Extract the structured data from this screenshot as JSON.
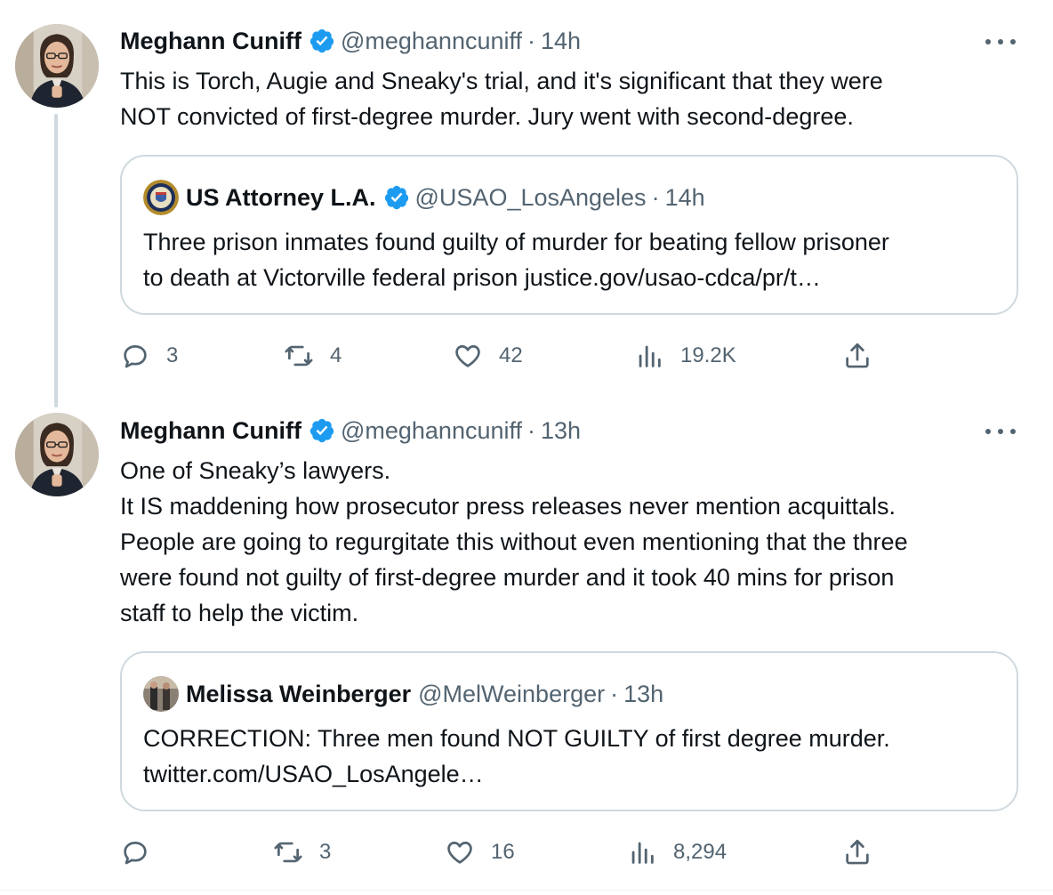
{
  "tweets": [
    {
      "author": {
        "name": "Meghann Cuniff",
        "handle": "@meghanncuniff",
        "dot": "·",
        "time": "14h",
        "avatar_icon": "profile-photo"
      },
      "text_lines": [
        "This is Torch, Augie and Sneaky's trial, and it's significant that they were",
        "NOT convicted of first-degree murder. Jury went with second-degree."
      ],
      "quote": {
        "name": "US Attorney L.A.",
        "handle": "@USAO_LosAngeles",
        "dot": "·",
        "time": "14h",
        "avatar_icon": "doj-seal",
        "verified": true,
        "text_lines": [
          "Three prison inmates found guilty of murder for beating fellow prisoner",
          "to death at Victorville federal prison justice.gov/usao-cdca/pr/t…"
        ]
      },
      "actions": {
        "replies": "3",
        "retweets": "4",
        "likes": "42",
        "views": "19.2K"
      }
    },
    {
      "author": {
        "name": "Meghann Cuniff",
        "handle": "@meghanncuniff",
        "dot": "·",
        "time": "13h",
        "avatar_icon": "profile-photo"
      },
      "text_lines": [
        "One of Sneaky’s lawyers.",
        "It IS maddening how prosecutor press releases never mention acquittals.",
        "People are going to regurgitate this without even mentioning that the three",
        "were found not guilty of first-degree murder and it took 40 mins for prison",
        "staff to help the victim."
      ],
      "quote": {
        "name": "Melissa Weinberger",
        "handle": "@MelWeinberger",
        "dot": "·",
        "time": "13h",
        "avatar_icon": "profile-photo",
        "verified": false,
        "text_lines": [
          "CORRECTION: Three men found NOT GUILTY of first degree murder.",
          "twitter.com/USAO_LosAngele…"
        ]
      },
      "actions": {
        "replies": "",
        "retweets": "3",
        "likes": "16",
        "views": "8,294"
      }
    }
  ],
  "colors": {
    "verified": "#1d9bf0",
    "secondary_text": "#536471",
    "border": "#cfd9de"
  },
  "icons": [
    "reply-icon",
    "retweet-icon",
    "like-icon",
    "views-icon",
    "share-icon",
    "more-icon",
    "verified-badge-icon"
  ]
}
